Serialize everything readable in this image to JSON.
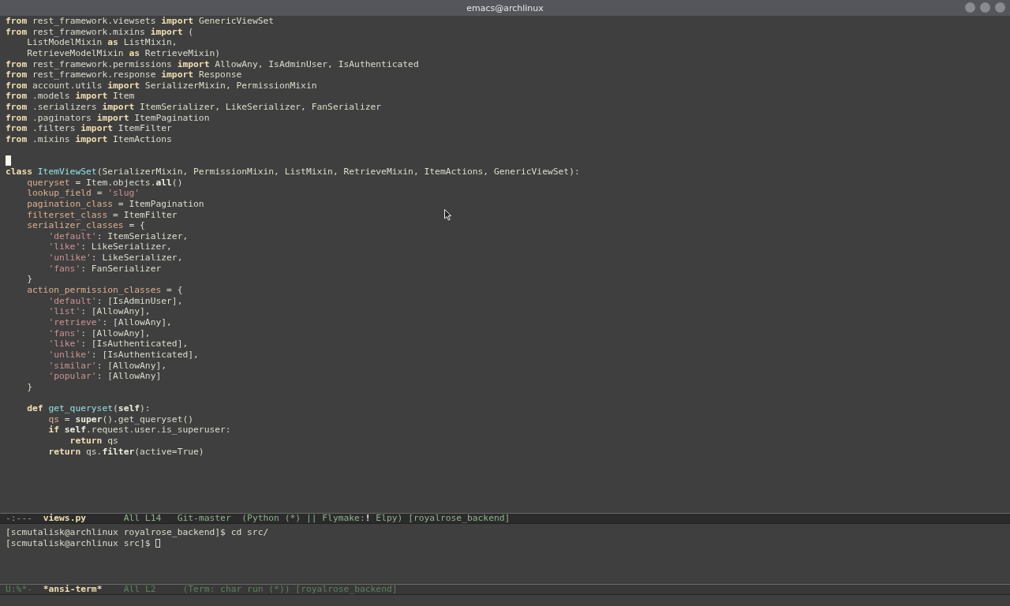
{
  "window": {
    "title": "emacs@archlinux"
  },
  "editor": {
    "lines": [
      {
        "cursor": false,
        "tokens": [
          {
            "kind": "kw",
            "text": "from"
          },
          {
            "kind": "plain",
            "text": " rest_framework.viewsets "
          },
          {
            "kind": "kw",
            "text": "import"
          },
          {
            "kind": "plain",
            "text": " GenericViewSet"
          }
        ]
      },
      {
        "cursor": false,
        "tokens": [
          {
            "kind": "kw",
            "text": "from"
          },
          {
            "kind": "plain",
            "text": " rest_framework.mixins "
          },
          {
            "kind": "kw",
            "text": "import"
          },
          {
            "kind": "plain",
            "text": " ("
          }
        ]
      },
      {
        "cursor": false,
        "tokens": [
          {
            "kind": "plain",
            "text": "    ListModelMixin "
          },
          {
            "kind": "kw",
            "text": "as"
          },
          {
            "kind": "plain",
            "text": " ListMixin,"
          }
        ]
      },
      {
        "cursor": false,
        "tokens": [
          {
            "kind": "plain",
            "text": "    RetrieveModelMixin "
          },
          {
            "kind": "kw",
            "text": "as"
          },
          {
            "kind": "plain",
            "text": " RetrieveMixin)"
          }
        ]
      },
      {
        "cursor": false,
        "tokens": [
          {
            "kind": "kw",
            "text": "from"
          },
          {
            "kind": "plain",
            "text": " rest_framework.permissions "
          },
          {
            "kind": "kw",
            "text": "import"
          },
          {
            "kind": "plain",
            "text": " AllowAny, IsAdminUser, IsAuthenticated"
          }
        ]
      },
      {
        "cursor": false,
        "tokens": [
          {
            "kind": "kw",
            "text": "from"
          },
          {
            "kind": "plain",
            "text": " rest_framework.response "
          },
          {
            "kind": "kw",
            "text": "import"
          },
          {
            "kind": "plain",
            "text": " Response"
          }
        ]
      },
      {
        "cursor": false,
        "tokens": [
          {
            "kind": "kw",
            "text": "from"
          },
          {
            "kind": "plain",
            "text": " account.utils "
          },
          {
            "kind": "kw",
            "text": "import"
          },
          {
            "kind": "plain",
            "text": " SerializerMixin, PermissionMixin"
          }
        ]
      },
      {
        "cursor": false,
        "tokens": [
          {
            "kind": "kw",
            "text": "from"
          },
          {
            "kind": "plain",
            "text": " .models "
          },
          {
            "kind": "kw",
            "text": "import"
          },
          {
            "kind": "plain",
            "text": " Item"
          }
        ]
      },
      {
        "cursor": false,
        "tokens": [
          {
            "kind": "kw",
            "text": "from"
          },
          {
            "kind": "plain",
            "text": " .serializers "
          },
          {
            "kind": "kw",
            "text": "import"
          },
          {
            "kind": "plain",
            "text": " ItemSerializer, LikeSerializer, FanSerializer"
          }
        ]
      },
      {
        "cursor": false,
        "tokens": [
          {
            "kind": "kw",
            "text": "from"
          },
          {
            "kind": "plain",
            "text": " .paginators "
          },
          {
            "kind": "kw",
            "text": "import"
          },
          {
            "kind": "plain",
            "text": " ItemPagination"
          }
        ]
      },
      {
        "cursor": false,
        "tokens": [
          {
            "kind": "kw",
            "text": "from"
          },
          {
            "kind": "plain",
            "text": " .filters "
          },
          {
            "kind": "kw",
            "text": "import"
          },
          {
            "kind": "plain",
            "text": " ItemFilter"
          }
        ]
      },
      {
        "cursor": false,
        "tokens": [
          {
            "kind": "kw",
            "text": "from"
          },
          {
            "kind": "plain",
            "text": " .mixins "
          },
          {
            "kind": "kw",
            "text": "import"
          },
          {
            "kind": "plain",
            "text": " ItemActions"
          }
        ]
      },
      {
        "cursor": false
      },
      {
        "cursor": true
      },
      {
        "cursor": false,
        "tokens": [
          {
            "kind": "kw",
            "text": "class"
          },
          {
            "kind": "def",
            "text": " ItemViewSet"
          },
          {
            "kind": "plain",
            "text": "(SerializerMixin, PermissionMixin, ListMixin, RetrieveMixin, ItemActions, GenericViewSet):"
          }
        ]
      },
      {
        "cursor": false,
        "tokens": [
          {
            "kind": "var",
            "text": "    queryset"
          },
          {
            "kind": "plain",
            "text": " = Item.objects."
          },
          {
            "kind": "bi",
            "text": "all"
          },
          {
            "kind": "plain",
            "text": "()"
          }
        ]
      },
      {
        "cursor": false,
        "tokens": [
          {
            "kind": "var",
            "text": "    lookup_field"
          },
          {
            "kind": "plain",
            "text": " = "
          },
          {
            "kind": "str",
            "text": "'slug'"
          }
        ]
      },
      {
        "cursor": false,
        "tokens": [
          {
            "kind": "var",
            "text": "    pagination_class"
          },
          {
            "kind": "plain",
            "text": " = ItemPagination"
          }
        ]
      },
      {
        "cursor": false,
        "tokens": [
          {
            "kind": "var",
            "text": "    filterset_class"
          },
          {
            "kind": "plain",
            "text": " = ItemFilter"
          }
        ]
      },
      {
        "cursor": false,
        "tokens": [
          {
            "kind": "var",
            "text": "    serializer_classes"
          },
          {
            "kind": "plain",
            "text": " = {"
          }
        ]
      },
      {
        "cursor": false,
        "tokens": [
          {
            "kind": "str",
            "text": "        'default'"
          },
          {
            "kind": "plain",
            "text": ": ItemSerializer,"
          }
        ]
      },
      {
        "cursor": false,
        "tokens": [
          {
            "kind": "str",
            "text": "        'like'"
          },
          {
            "kind": "plain",
            "text": ": LikeSerializer,"
          }
        ]
      },
      {
        "cursor": false,
        "tokens": [
          {
            "kind": "str",
            "text": "        'unlike'"
          },
          {
            "kind": "plain",
            "text": ": LikeSerializer,"
          }
        ]
      },
      {
        "cursor": false,
        "tokens": [
          {
            "kind": "str",
            "text": "        'fans'"
          },
          {
            "kind": "plain",
            "text": ": FanSerializer"
          }
        ]
      },
      {
        "cursor": false,
        "tokens": [
          {
            "kind": "plain",
            "text": "    }"
          }
        ]
      },
      {
        "cursor": false,
        "tokens": [
          {
            "kind": "var",
            "text": "    action_permission_classes"
          },
          {
            "kind": "plain",
            "text": " = {"
          }
        ]
      },
      {
        "cursor": false,
        "tokens": [
          {
            "kind": "str",
            "text": "        'default'"
          },
          {
            "kind": "plain",
            "text": ": [IsAdminUser],"
          }
        ]
      },
      {
        "cursor": false,
        "tokens": [
          {
            "kind": "str",
            "text": "        'list'"
          },
          {
            "kind": "plain",
            "text": ": [AllowAny],"
          }
        ]
      },
      {
        "cursor": false,
        "tokens": [
          {
            "kind": "str",
            "text": "        'retrieve'"
          },
          {
            "kind": "plain",
            "text": ": [AllowAny],"
          }
        ]
      },
      {
        "cursor": false,
        "tokens": [
          {
            "kind": "str",
            "text": "        'fans'"
          },
          {
            "kind": "plain",
            "text": ": [AllowAny],"
          }
        ]
      },
      {
        "cursor": false,
        "tokens": [
          {
            "kind": "str",
            "text": "        'like'"
          },
          {
            "kind": "plain",
            "text": ": [IsAuthenticated],"
          }
        ]
      },
      {
        "cursor": false,
        "tokens": [
          {
            "kind": "str",
            "text": "        'unlike'"
          },
          {
            "kind": "plain",
            "text": ": [IsAuthenticated],"
          }
        ]
      },
      {
        "cursor": false,
        "tokens": [
          {
            "kind": "str",
            "text": "        'similar'"
          },
          {
            "kind": "plain",
            "text": ": [AllowAny],"
          }
        ]
      },
      {
        "cursor": false,
        "tokens": [
          {
            "kind": "str",
            "text": "        'popular'"
          },
          {
            "kind": "plain",
            "text": ": [AllowAny]"
          }
        ]
      },
      {
        "cursor": false,
        "tokens": [
          {
            "kind": "plain",
            "text": "    }"
          }
        ]
      },
      {
        "cursor": false
      },
      {
        "cursor": false,
        "tokens": [
          {
            "kind": "kw",
            "text": "    def"
          },
          {
            "kind": "def",
            "text": " get_queryset"
          },
          {
            "kind": "plain",
            "text": "("
          },
          {
            "kind": "bi",
            "text": "self"
          },
          {
            "kind": "plain",
            "text": "):"
          }
        ]
      },
      {
        "cursor": false,
        "tokens": [
          {
            "kind": "var",
            "text": "        qs"
          },
          {
            "kind": "plain",
            "text": " = "
          },
          {
            "kind": "bi",
            "text": "super"
          },
          {
            "kind": "plain",
            "text": "().get_queryset()"
          }
        ]
      },
      {
        "cursor": false,
        "tokens": [
          {
            "kind": "kw",
            "text": "        if"
          },
          {
            "kind": "bi",
            "text": " self"
          },
          {
            "kind": "plain",
            "text": ".request.user.is_superuser:"
          }
        ]
      },
      {
        "cursor": false,
        "tokens": [
          {
            "kind": "kw",
            "text": "            return"
          },
          {
            "kind": "plain",
            "text": " qs"
          }
        ]
      },
      {
        "cursor": false,
        "tokens": [
          {
            "kind": "kw",
            "text": "        return"
          },
          {
            "kind": "plain",
            "text": " qs."
          },
          {
            "kind": "bi",
            "text": "filter"
          },
          {
            "kind": "plain",
            "text": "(active=True)"
          }
        ]
      }
    ]
  },
  "editor_mode_line": {
    "active": true,
    "segments": [
      {
        "kind": "status",
        "text": "-:---"
      },
      {
        "kind": "buffer",
        "text": "views.py"
      },
      {
        "kind": "info",
        "text": "All L14"
      },
      {
        "kind": "info",
        "text": "Git-master"
      },
      {
        "kind": "info",
        "text": "(Python (*) || Flymake:**!** Elpy) [royalrose_backend]"
      }
    ]
  },
  "terminal": {
    "lines": [
      {
        "text": "[scmutalisk@archlinux royalrose_backend]$ cd src/",
        "cursor": false
      },
      {
        "text": "[scmutalisk@archlinux src]$",
        "cursor": true
      }
    ]
  },
  "terminal_mode_line": {
    "active": false,
    "segments": [
      {
        "kind": "status",
        "text": "U:%*-"
      },
      {
        "kind": "buffer",
        "text": "*ansi-term*"
      },
      {
        "kind": "info",
        "text": "All L2"
      },
      {
        "kind": "info",
        "text": "(Term: char run (*)) [royalrose_backend]"
      }
    ]
  }
}
